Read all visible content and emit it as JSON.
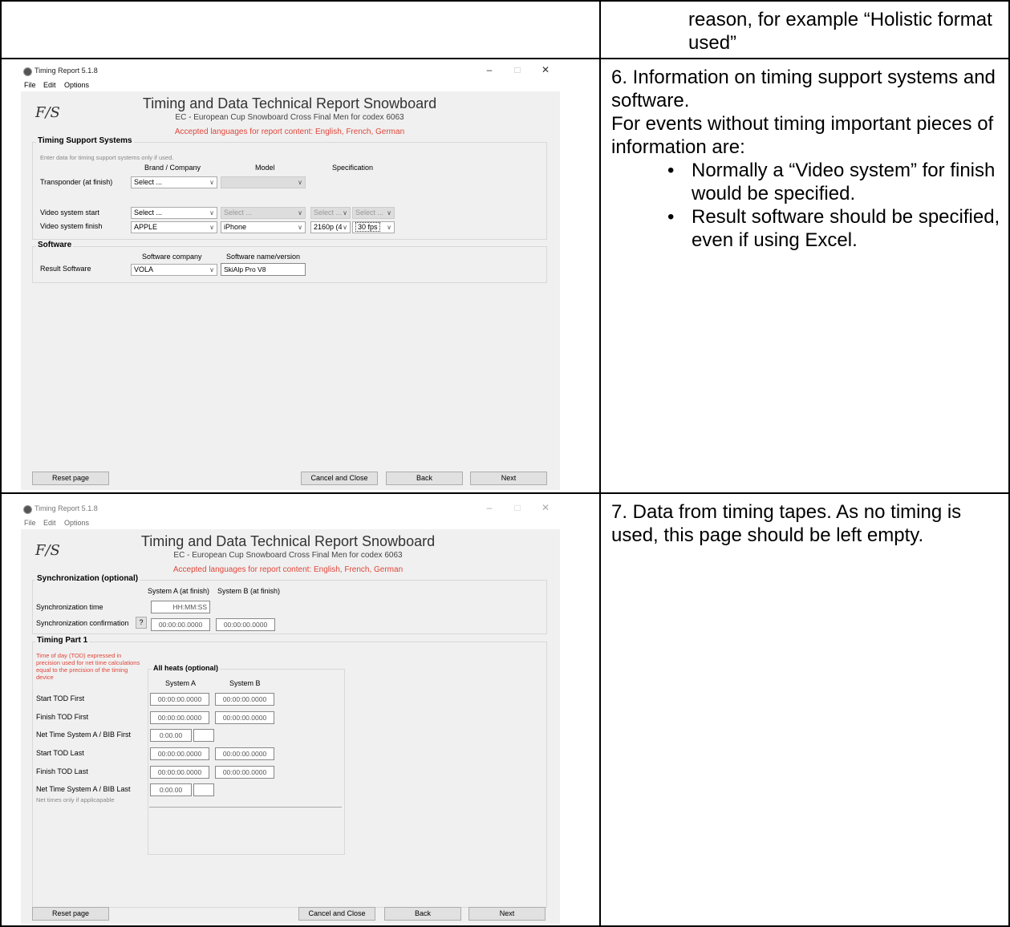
{
  "doc": {
    "row1_text": "reason, for example “Holistic format used”",
    "row2_heading": "6. Information on timing support systems and software.",
    "row2_intro": "For events without timing important pieces of information are:",
    "row2_bullets": [
      "Normally a “Video system” for finish would be specified.",
      "Result software should be specified, even if using Excel."
    ],
    "row3_text": "7. Data from timing tapes. As no timing is used, this page should be left empty."
  },
  "window": {
    "title": "Timing Report 5.1.8",
    "minimize": "–",
    "maximize": "□",
    "close": "✕",
    "menu": [
      "File",
      "Edit",
      "Options"
    ],
    "logo_text": "F/S",
    "report_title": "Timing and Data Technical Report Snowboard",
    "event_subtitle": "EC - European Cup Snowboard Cross Final Men for codex 6063",
    "languages_note": "Accepted languages for report content: English, French, German",
    "buttons": {
      "reset": "Reset page",
      "cancel": "Cancel and Close",
      "back": "Back",
      "next": "Next"
    }
  },
  "page6": {
    "support_group": "Timing Support Systems",
    "support_hint": "Enter data for timing support systems only if used.",
    "col_brand": "Brand / Company",
    "col_model": "Model",
    "col_spec": "Specification",
    "transponder_label": "Transponder (at finish)",
    "transponder_brand": "Select ...",
    "video_start_label": "Video system start",
    "video_start_brand": "Select ...",
    "video_start_model": "Select ...",
    "video_start_spec1": "Select ...",
    "video_start_spec2": "Select ...",
    "video_finish_label": "Video system finish",
    "video_finish_brand": "APPLE",
    "video_finish_model": "iPhone",
    "video_finish_res": "2160p (4",
    "video_finish_fps": "30 fps",
    "software_group": "Software",
    "col_sw_company": "Software company",
    "col_sw_name": "Software name/version",
    "result_sw_label": "Result Software",
    "result_sw_company": "VOLA",
    "result_sw_name": "SkiAlp Pro V8"
  },
  "page7": {
    "sync_group": "Synchronization (optional)",
    "col_sys_a": "System A (at finish)",
    "col_sys_b": "System B (at finish)",
    "sync_time_label": "Synchronization time",
    "sync_time_value": "HH:MM:SS",
    "sync_conf_label": "Synchronization confirmation",
    "help_btn": "?",
    "sync_conf_a": "00:00:00.0000",
    "sync_conf_b": "00:00:00.0000",
    "timing_group": "Timing Part 1",
    "tod_note": "Time of day (TOD) expressed in precision used for net time calculations equal to the precision of the timing device",
    "all_heats": "All heats (optional)",
    "system_a": "System A",
    "system_b": "System B",
    "rows": [
      {
        "label": "Start TOD First",
        "a": "00:00:00.0000",
        "b": "00:00:00.0000"
      },
      {
        "label": "Finish TOD First",
        "a": "00:00:00.0000",
        "b": "00:00:00.0000"
      },
      {
        "label": "Net Time System A / BIB First",
        "a": "0:00.00",
        "b": ""
      },
      {
        "label": "Start TOD Last",
        "a": "00:00:00.0000",
        "b": "00:00:00.0000"
      },
      {
        "label": "Finish TOD Last",
        "a": "00:00:00.0000",
        "b": "00:00:00.0000"
      },
      {
        "label": "Net Time System A / BIB Last",
        "a": "0:00.00",
        "b": ""
      }
    ],
    "net_note": "Net times only if applicapable"
  }
}
